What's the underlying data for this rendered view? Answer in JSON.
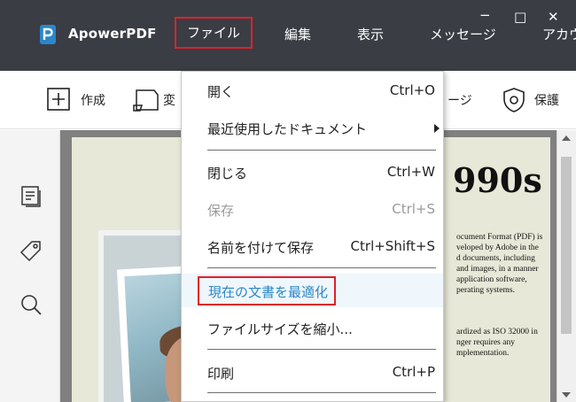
{
  "app": {
    "name": "ApowerPDF",
    "brand_color": "#2a87c9",
    "highlight_color": "#e0202a"
  },
  "menubar": {
    "items": [
      "ファイル",
      "編集",
      "表示",
      "メッセージ",
      "アカウ"
    ]
  },
  "window": {
    "minimize": "−",
    "maximize": "□",
    "close": "✕"
  },
  "toolbar": {
    "create": "作成",
    "convert": "変",
    "page": "ージ",
    "protect": "保護"
  },
  "document": {
    "heading": "990s",
    "para1": [
      "ocument Format (PDF) is",
      "veloped by Adobe in the",
      "d documents, including",
      "and images, in a manner",
      "application software,",
      "perating systems."
    ],
    "para2": [
      "ardized as ISO 32000 in",
      "nger requires any",
      "mplementation."
    ]
  },
  "file_menu": {
    "open": {
      "label": "開く",
      "shortcut": "Ctrl+O"
    },
    "recent": {
      "label": "最近使用したドキュメント"
    },
    "close": {
      "label": "閉じる",
      "shortcut": "Ctrl+W"
    },
    "save": {
      "label": "保存",
      "shortcut": "Ctrl+S"
    },
    "save_as": {
      "label": "名前を付けて保存",
      "shortcut": "Ctrl+Shift+S"
    },
    "optimize": {
      "label": "現在の文書を最適化"
    },
    "reduce": {
      "label": "ファイルサイズを縮小..."
    },
    "print": {
      "label": "印刷",
      "shortcut": "Ctrl+P"
    }
  }
}
